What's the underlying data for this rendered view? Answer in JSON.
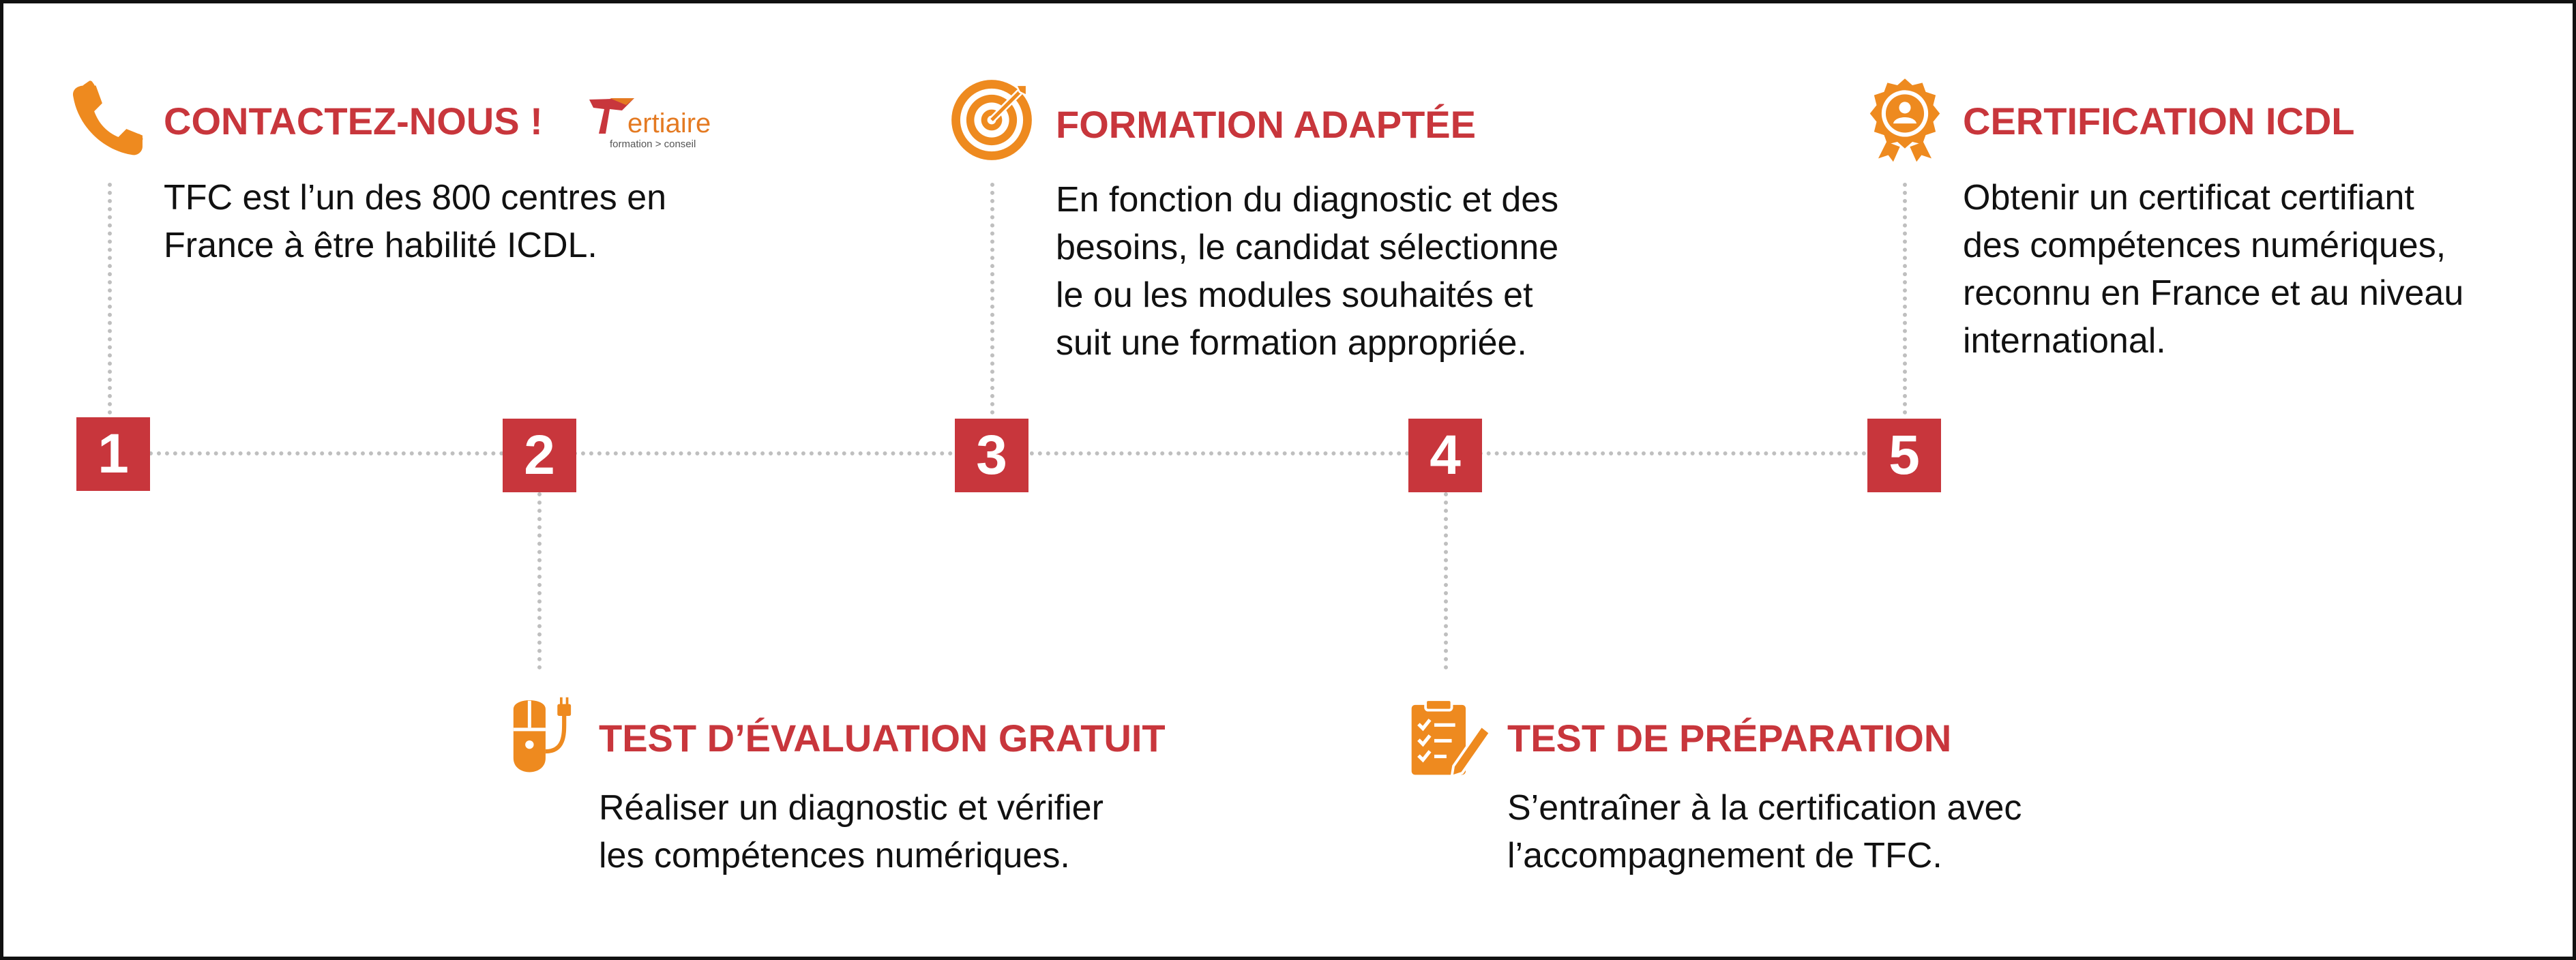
{
  "colors": {
    "accent_red": "#c8363c",
    "icon_orange": "#ee8a1f",
    "connector_gray": "#bfbfbf",
    "text": "#111111"
  },
  "steps": [
    {
      "number": "1",
      "icon": "phone-icon",
      "title": "CONTACTEZ-NOUS !",
      "lines": [
        "TFC est l’un des 800 centres en",
        "France à être habilité ICDL."
      ]
    },
    {
      "number": "2",
      "icon": "mouse-icon",
      "title": "TEST D’ÉVALUATION GRATUIT",
      "lines": [
        "Réaliser un diagnostic et vérifier",
        "les compétences numériques."
      ]
    },
    {
      "number": "3",
      "icon": "target-icon",
      "title": "FORMATION ADAPTÉE",
      "lines": [
        "En fonction du diagnostic et des",
        "besoins, le candidat sélectionne",
        "le ou les modules souhaités et",
        "suit une formation appropriée."
      ]
    },
    {
      "number": "4",
      "icon": "checklist-icon",
      "title": "TEST DE PRÉPARATION",
      "lines": [
        "S’entraîner à la certification avec",
        "l’accompagnement de TFC."
      ]
    },
    {
      "number": "5",
      "icon": "badge-icon",
      "title": "CERTIFICATION ICDL",
      "lines": [
        "Obtenir un certificat certifiant",
        "des compétences numériques,",
        "reconnu en France et au niveau",
        "international."
      ]
    }
  ],
  "logo": {
    "name": "Tertiaire",
    "tagline": "formation > conseil"
  }
}
